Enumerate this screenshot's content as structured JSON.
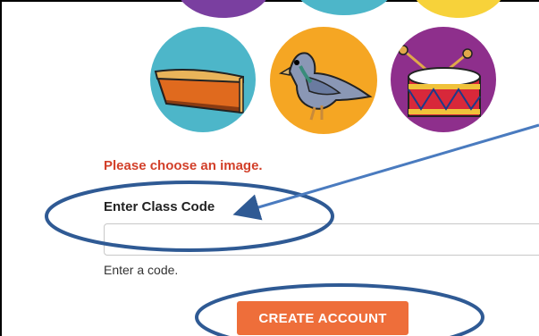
{
  "avatars": [
    {
      "name": "pie",
      "color": "#4db6c9"
    },
    {
      "name": "pigeon",
      "color": "#f5a623"
    },
    {
      "name": "drum",
      "color": "#8e2f8c"
    }
  ],
  "top_partial_colors": [
    "#7a3fa0",
    "#4db6c9",
    "#f7d23a"
  ],
  "error_message": "Please choose an image.",
  "class_code": {
    "label": "Enter Class Code",
    "value": "",
    "placeholder": "",
    "hint": "Enter a code."
  },
  "create_account_label": "CREATE ACCOUNT",
  "annotation_color": "#2f5a94"
}
